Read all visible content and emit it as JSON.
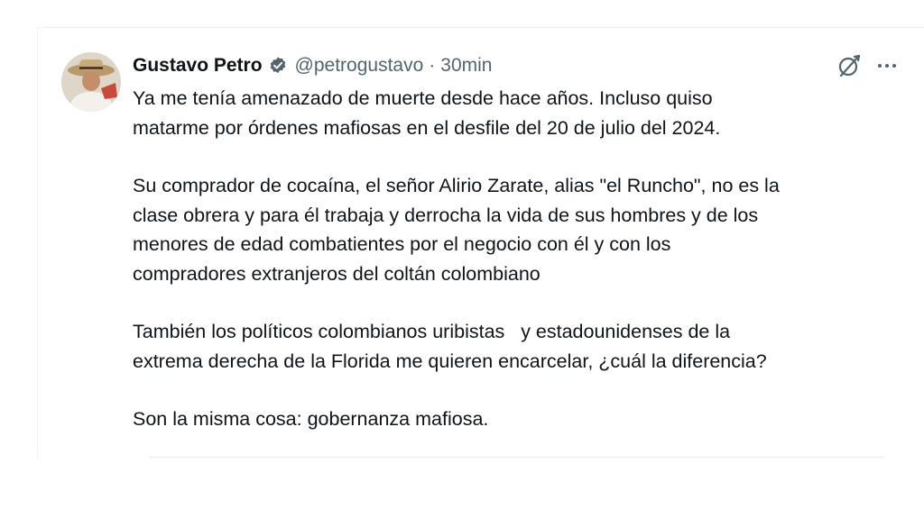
{
  "tweet": {
    "author": {
      "display_name": "Gustavo Petro",
      "handle": "@petrogustavo",
      "verified": true,
      "avatar": "profile-photo-hat"
    },
    "separator": "·",
    "time": "30min",
    "icons": {
      "grok": "slashed-circle-icon",
      "more": "more-dots-icon"
    },
    "paragraphs": [
      {
        "lines": [
          "Ya me tenía amenazado de muerte desde hace años. Incluso quiso",
          "matarme por órdenes mafiosas en el desfile del 20 de julio del 2024."
        ]
      },
      {
        "lines": [
          "Su comprador de cocaína, el señor Alirio Zarate, alias \"el Runcho\", no es la",
          "clase obrera y para él trabaja y derrocha la vida de sus hombres y de los",
          "menores de edad combatientes por el negocio con él y con los",
          "compradores extranjeros del coltán colombiano"
        ]
      },
      {
        "lines": [
          "También los políticos colombianos uribistas   y estadounidenses de la",
          "extrema derecha de la Florida me quieren encarcelar, ¿cuál la diferencia?"
        ]
      },
      {
        "lines": [
          "Son la misma cosa: gobernanza mafiosa."
        ]
      }
    ]
  },
  "colors": {
    "text": "#0f1419",
    "secondary": "#536471",
    "verified_badge": "#536471",
    "border": "#eff3f4"
  }
}
